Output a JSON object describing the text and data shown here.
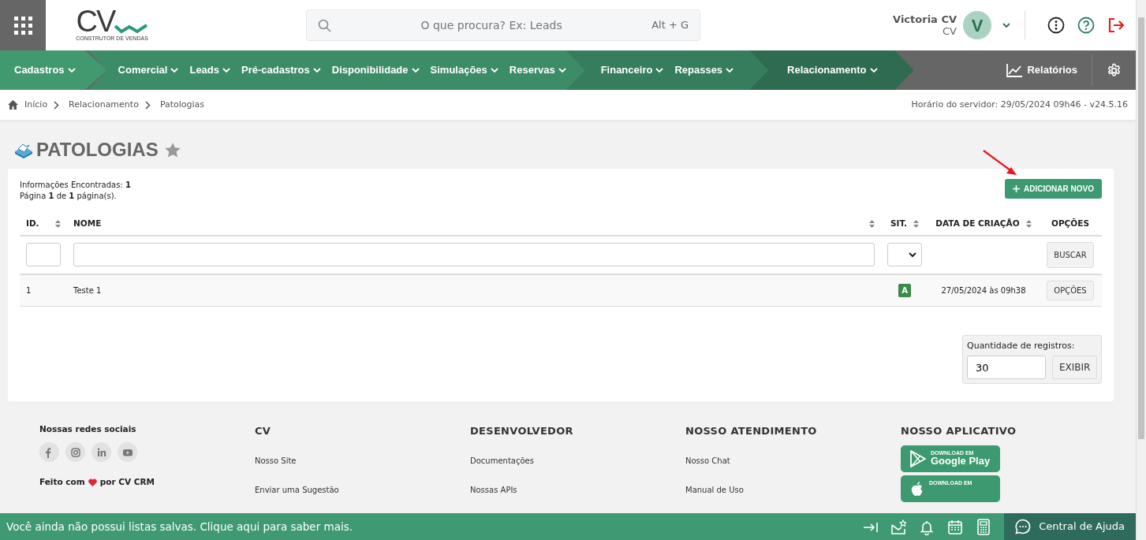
{
  "logo": {
    "mark": "CV",
    "tagline": "CONSTRUTOR DE VENDAS"
  },
  "search": {
    "placeholder": "O que procura? Ex: Leads",
    "shortcut": "Alt + G"
  },
  "user": {
    "name": "Victoria CV",
    "company": "CV",
    "initial": "V"
  },
  "nav": {
    "sections": [
      {
        "items": [
          "Cadastros"
        ]
      },
      {
        "items": [
          "Comercial",
          "Leads",
          "Pré-cadastros",
          "Disponibilidade",
          "Simulações",
          "Reservas"
        ]
      },
      {
        "items": [
          "Financeiro",
          "Repasses"
        ]
      },
      {
        "items": [
          "Relacionamento"
        ]
      }
    ],
    "reports": "Relatórios"
  },
  "breadcrumb": [
    "Início",
    "Relacionamento",
    "Patologias"
  ],
  "server_time": "Horário do servidor: 29/05/2024 09h46 - v24.5.16",
  "page": {
    "title": "PATOLOGIAS",
    "favorite": false
  },
  "summary": [
    "Informações Encontradas: **1**",
    "Página **1** de **1** página(s)."
  ],
  "add_button": "ADICIONAR NOVO",
  "table": {
    "columns": [
      {
        "label": "ID.",
        "sortable": true
      },
      {
        "label": "NOME",
        "sortable": true
      },
      {
        "label": "SIT.",
        "sortable": true
      },
      {
        "label": "DATA DE CRIAÇÃO",
        "sortable": true
      },
      {
        "label": "OPÇÕES",
        "sortable": false
      }
    ],
    "search_button": "BUSCAR",
    "rows": [
      {
        "id": "1",
        "name": "Teste 1",
        "status": "A",
        "date": "27/05/2024 às 09h38",
        "options": "OPÇÕES"
      }
    ]
  },
  "page_size": {
    "label": "Quantidade de registros:",
    "value": "30",
    "button": "EXIBIR"
  },
  "footer": {
    "social_title": "Nossas redes sociais",
    "made_with": [
      "Feito com",
      "por CV CRM"
    ],
    "columns": [
      {
        "title": "CV",
        "links": [
          "Nosso Site",
          "Enviar uma Sugestão"
        ]
      },
      {
        "title": "DESENVOLVEDOR",
        "links": [
          "Documentações",
          "Nossas APIs"
        ]
      },
      {
        "title": "NOSSO ATENDIMENTO",
        "links": [
          "Nosso Chat",
          "Manual de Uso"
        ]
      }
    ],
    "app_title": "NOSSO APLICATIVO",
    "stores": [
      {
        "kind": "google",
        "small": "DOWNLOAD EM",
        "name": "Google Play"
      },
      {
        "kind": "apple",
        "small": "DOWNLOAD EM"
      }
    ]
  },
  "bottom_bar": {
    "message": "Você ainda não possui listas salvas. Clique aqui para saber mais.",
    "help": "Central de Ajuda"
  }
}
